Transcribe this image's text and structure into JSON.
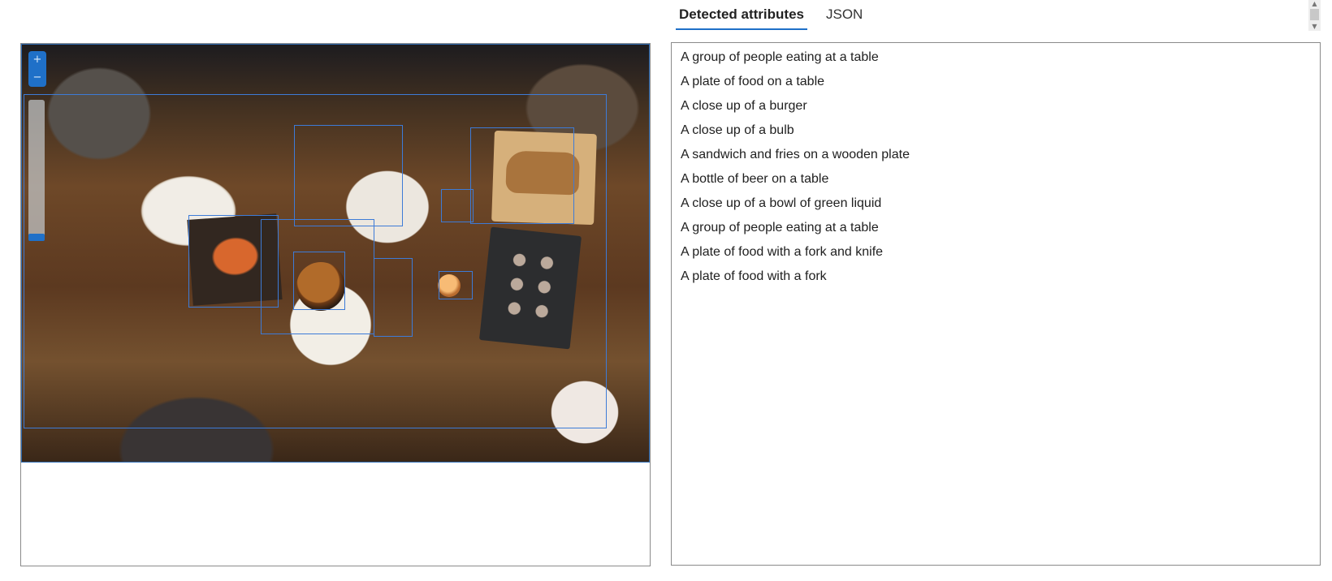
{
  "tabs": {
    "detected_attributes": "Detected attributes",
    "json": "JSON"
  },
  "image": {
    "alt": "Overhead view of people eating food at a wooden table",
    "zoom_in": "+",
    "zoom_out": "−"
  },
  "attributes": [
    "A group of people eating at a table",
    "A plate of food on a table",
    "A close up of a burger",
    "A close up of a bulb",
    "A sandwich and fries on a wooden plate",
    "A bottle of beer on a table",
    "A close up of a bowl of green liquid",
    "A group of people eating at a table",
    "A plate of food with a fork and knife",
    "A plate of food with a fork"
  ],
  "colors": {
    "accent": "#1f70c8",
    "box": "#3d7bd7",
    "border": "#8a8a8a"
  }
}
